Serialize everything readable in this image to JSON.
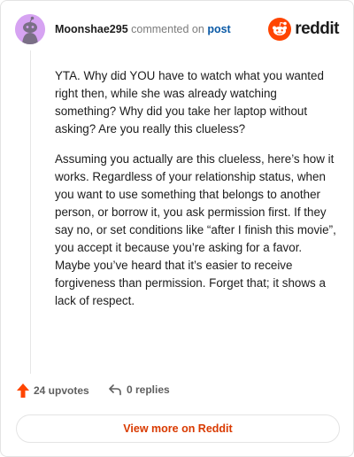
{
  "header": {
    "username": "Moonshae295",
    "action_text": "commented on",
    "post_link": "post",
    "logo_text": "reddit"
  },
  "comment": {
    "paragraphs": [
      "YTA. Why did YOU have to watch what you wanted right then, while she was already watching something? Why did you take her laptop without asking? Are you really this clueless?",
      "Assuming you actually are this clueless, here’s how it works. Regardless of your relationship status, when you want to use something that belongs to another person, or borrow it, you ask permission first. If they say no, or set conditions like “after I finish this movie”, you accept it because you’re asking for a favor. Maybe you’ve heard that it’s easier to receive forgiveness than permission. Forget that; it shows a lack of respect."
    ]
  },
  "footer": {
    "upvotes": "24 upvotes",
    "replies": "0 replies"
  },
  "actions": {
    "view_more": "View more on Reddit"
  },
  "colors": {
    "brand": "#ff4500",
    "link": "#0b5aa6",
    "view_more_text": "#d93a00",
    "avatar_bg": "#d6a3f2"
  },
  "icons": [
    "snoo-avatar-icon",
    "reddit-logo-icon",
    "upvote-arrow-icon",
    "reply-arrow-icon"
  ]
}
